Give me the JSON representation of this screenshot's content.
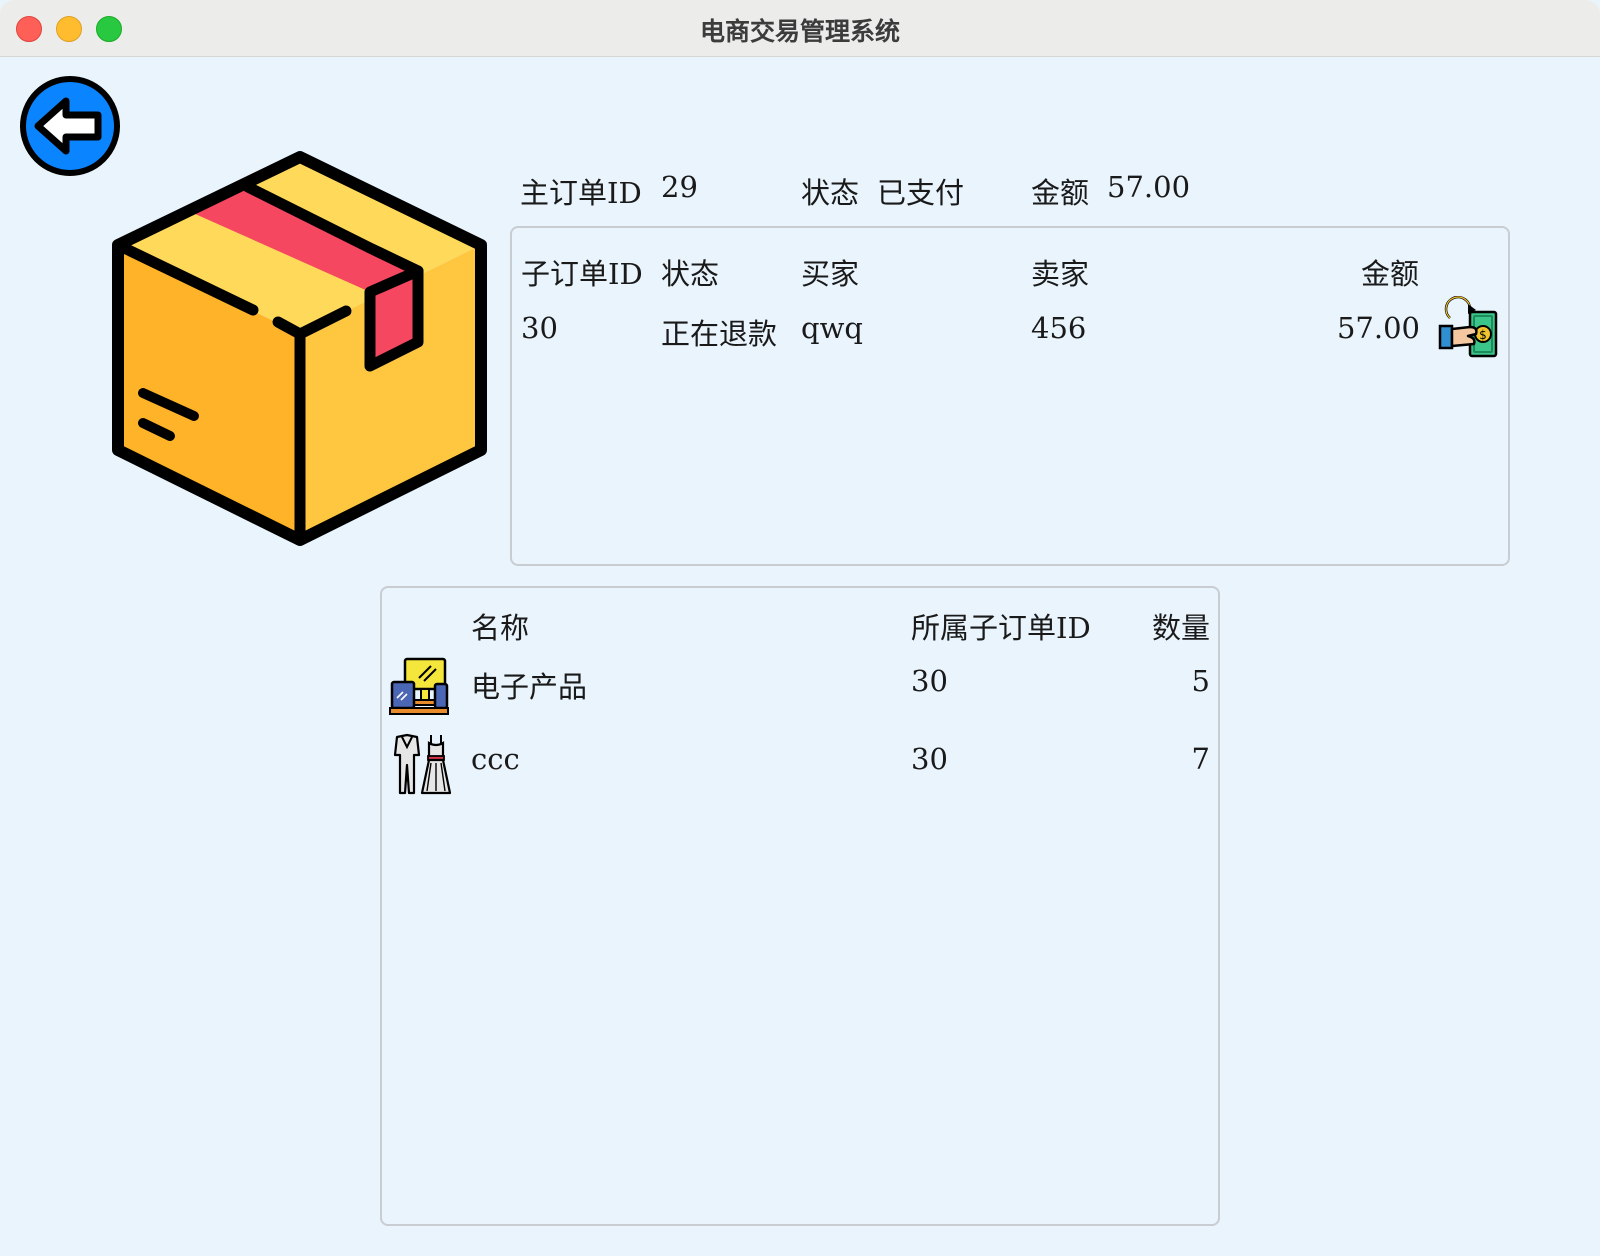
{
  "window": {
    "title": "电商交易管理系统"
  },
  "main_order": {
    "id_label": "主订单ID",
    "id_value": "29",
    "status_label": "状态",
    "status_value": "已支付",
    "amount_label": "金额",
    "amount_value": "57.00"
  },
  "sub_orders": {
    "headers": {
      "id": "子订单ID",
      "status": "状态",
      "buyer": "买家",
      "seller": "卖家",
      "amount": "金额"
    },
    "rows": [
      {
        "id": "30",
        "status": "正在退款",
        "buyer": "qwq",
        "seller": "456",
        "amount": "57.00",
        "action_icon": "refund-icon"
      }
    ]
  },
  "items": {
    "headers": {
      "name": "名称",
      "sub_order_id": "所属子订单ID",
      "quantity": "数量"
    },
    "rows": [
      {
        "icon": "electronics-icon",
        "name": "电子产品",
        "sub_order_id": "30",
        "quantity": "5"
      },
      {
        "icon": "clothing-icon",
        "name": "ccc",
        "sub_order_id": "30",
        "quantity": "7"
      }
    ]
  },
  "colors": {
    "background": "#e9f4fc",
    "back_button": "#0a84ff",
    "box_front": "#ffb328",
    "box_side": "#ffc63f",
    "box_top": "#ffd95a",
    "box_tape": "#f5475f"
  },
  "icons": {
    "back": "back-arrow-icon",
    "illustration": "package-box-icon"
  }
}
